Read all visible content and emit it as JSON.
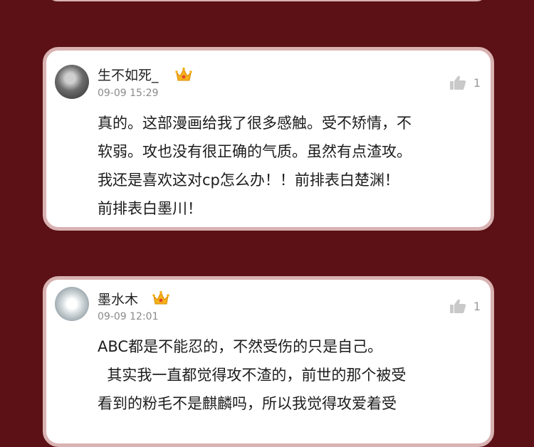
{
  "comments": [
    {
      "username": "生不如死_",
      "date": "09-09 15:29",
      "likes": "1",
      "content": "真的。这部漫画给我了很多感触。受不矫情，不\n软弱。攻也没有很正确的气质。虽然有点渣攻。\n我还是喜欢这对cp怎么办！！前排表白楚渊！\n前排表白墨川！"
    },
    {
      "username": "墨水木",
      "date": "09-09 12:01",
      "likes": "1",
      "content": "ABC都是不能忍的，不然受伤的只是自己。\n  其实我一直都觉得攻不渣的，前世的那个被受\n看到的粉毛不是麒麟吗，所以我觉得攻爱着受"
    }
  ]
}
